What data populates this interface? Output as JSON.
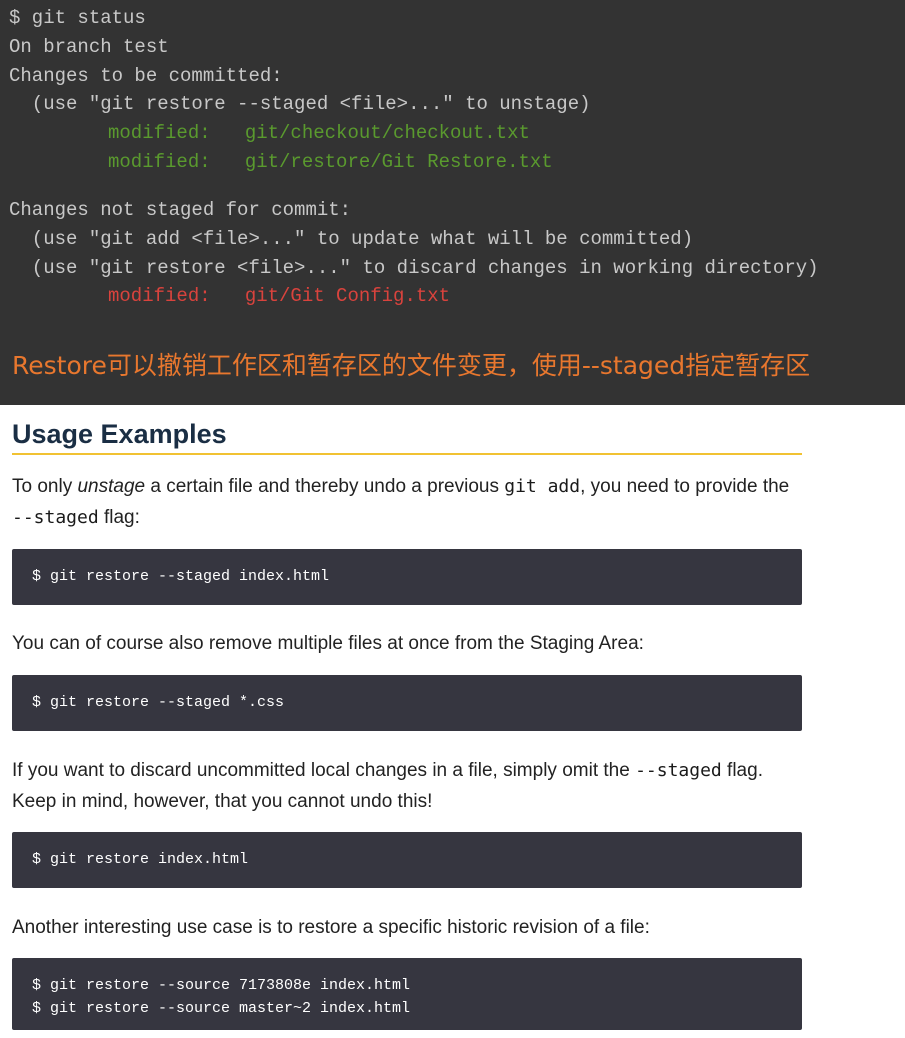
{
  "terminal": {
    "lines": [
      "$ git status",
      "On branch test",
      "Changes to be committed:",
      "  (use \"git restore --staged <file>...\" to unstage)",
      "modified:   git/checkout/checkout.txt",
      "modified:   git/restore/Git Restore.txt",
      "Changes not staged for commit:",
      "  (use \"git add <file>...\" to update what will be committed)",
      "  (use \"git restore <file>...\" to discard changes in working directory)",
      "modified:   git/Git Config.txt"
    ],
    "caption": "Restore可以撤销工作区和暂存区的文件变更，使用--staged指定暂存区"
  },
  "doc": {
    "heading": "Usage Examples",
    "p1": {
      "a": "To only ",
      "em": "unstage",
      "b": " a certain file and thereby undo a previous ",
      "code1": "git add",
      "c": ", you need to provide the ",
      "code2": "--staged",
      "d": " flag:"
    },
    "code1": [
      "$ git restore --staged index.html"
    ],
    "p2": "You can of course also remove multiple files at once from the Staging Area:",
    "code2": [
      "$ git restore --staged *.css"
    ],
    "p3": {
      "a": "If you want to discard uncommitted local changes in a file, simply omit the ",
      "code": "--staged",
      "b": " flag. Keep in mind, however, that you cannot undo this!"
    },
    "code3": [
      "$ git restore index.html"
    ],
    "p4": "Another interesting use case is to restore a specific historic revision of a file:",
    "code4": [
      "$ git restore --source 7173808e index.html",
      "$ git restore --source master~2 index.html"
    ]
  },
  "colors": {
    "terminal_bg": "#333333",
    "terminal_text": "#c8c8c8",
    "staged_green": "#5a9a2e",
    "unstaged_red": "#d9433d",
    "caption_orange": "#e8772e",
    "heading": "#1a2e44",
    "heading_rule": "#f1c232",
    "codebox_bg": "#363640"
  }
}
